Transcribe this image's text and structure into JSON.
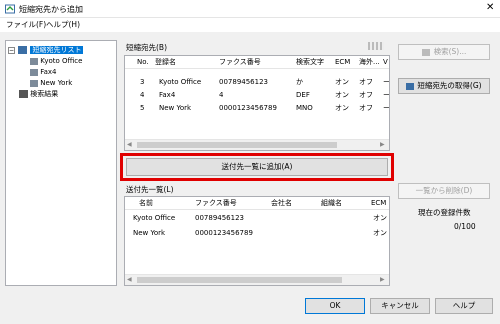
{
  "window": {
    "title": "短縮宛先から追加"
  },
  "menu": {
    "file": "ファイル(F)",
    "help": "ヘルプ(H)"
  },
  "tree": {
    "root": "短縮宛先リスト",
    "children": [
      "Kyoto Office",
      "Fax4",
      "New York"
    ],
    "results": "検索結果"
  },
  "speed_dial": {
    "label": "短縮宛先(B)",
    "columns": [
      "No.",
      "登録名",
      "ファクス番号",
      "検索文字",
      "ECM",
      "海外...",
      "V"
    ],
    "rows": [
      [
        "3",
        "Kyoto Office",
        "00789456123",
        "か",
        "オン",
        "オフ",
        "ー"
      ],
      [
        "4",
        "Fax4",
        "4",
        "DEF",
        "オン",
        "オフ",
        "ー"
      ],
      [
        "5",
        "New York",
        "0000123456789",
        "MNO",
        "オン",
        "オフ",
        "ー"
      ]
    ]
  },
  "buttons": {
    "search": "検索(S)...",
    "get_speed_dial": "短縮宛先の取得(G)",
    "add_to_list": "送付先一覧に追加(A)",
    "remove_from_list": "一覧から削除(D)",
    "ok": "OK",
    "cancel": "キャンセル",
    "help": "ヘルプ"
  },
  "destinations": {
    "label": "送付先一覧(L)",
    "columns": [
      "名前",
      "ファクス番号",
      "会社名",
      "組織名",
      "ECM"
    ],
    "rows": [
      [
        "Kyoto Office",
        "00789456123",
        "",
        "",
        "オン"
      ],
      [
        "New York",
        "0000123456789",
        "",
        "",
        "オン"
      ]
    ]
  },
  "count": {
    "label": "現在の登録件数",
    "value": "0/100"
  }
}
